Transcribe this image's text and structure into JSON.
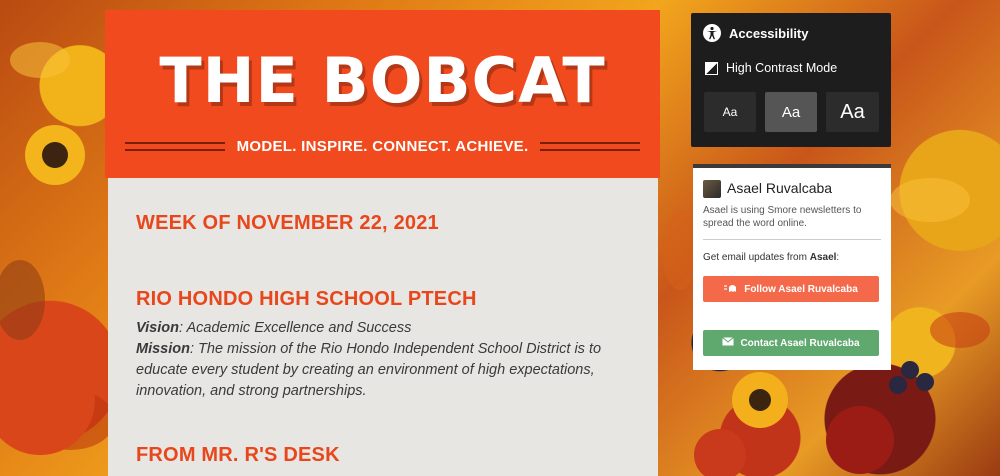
{
  "header": {
    "title": "THE BOBCAT",
    "tagline": "MODEL. INSPIRE. CONNECT. ACHIEVE."
  },
  "content": {
    "week_heading": "WEEK OF NOVEMBER 22, 2021",
    "school_heading": "RIO HONDO HIGH SCHOOL PTECH",
    "vision_label": "Vision",
    "vision_text": ": Academic Excellence and Success",
    "mission_label": "Mission",
    "mission_text": ": The mission of the Rio Hondo Independent School District is to educate every student by creating an environment of high expectations, innovation, and strong partnerships.",
    "desk_heading": "FROM MR. R'S DESK"
  },
  "accessibility": {
    "title": "Accessibility",
    "high_contrast_label": "High Contrast Mode",
    "size_small": "Aa",
    "size_medium": "Aa",
    "size_large": "Aa"
  },
  "author_card": {
    "name": "Asael Ruvalcaba",
    "description": "Asael is using Smore newsletters to spread the word online.",
    "email_prefix": "Get email updates from ",
    "email_name": "Asael",
    "email_suffix": ":",
    "follow_label": "Follow Asael Ruvalcaba",
    "contact_label": "Contact Asael Ruvalcaba"
  },
  "colors": {
    "header_orange": "#f04a1e",
    "heading_orange": "#e8471c",
    "follow_button": "#f4694a",
    "contact_button": "#5fa86e",
    "panel_dark": "#1d1d1d"
  }
}
